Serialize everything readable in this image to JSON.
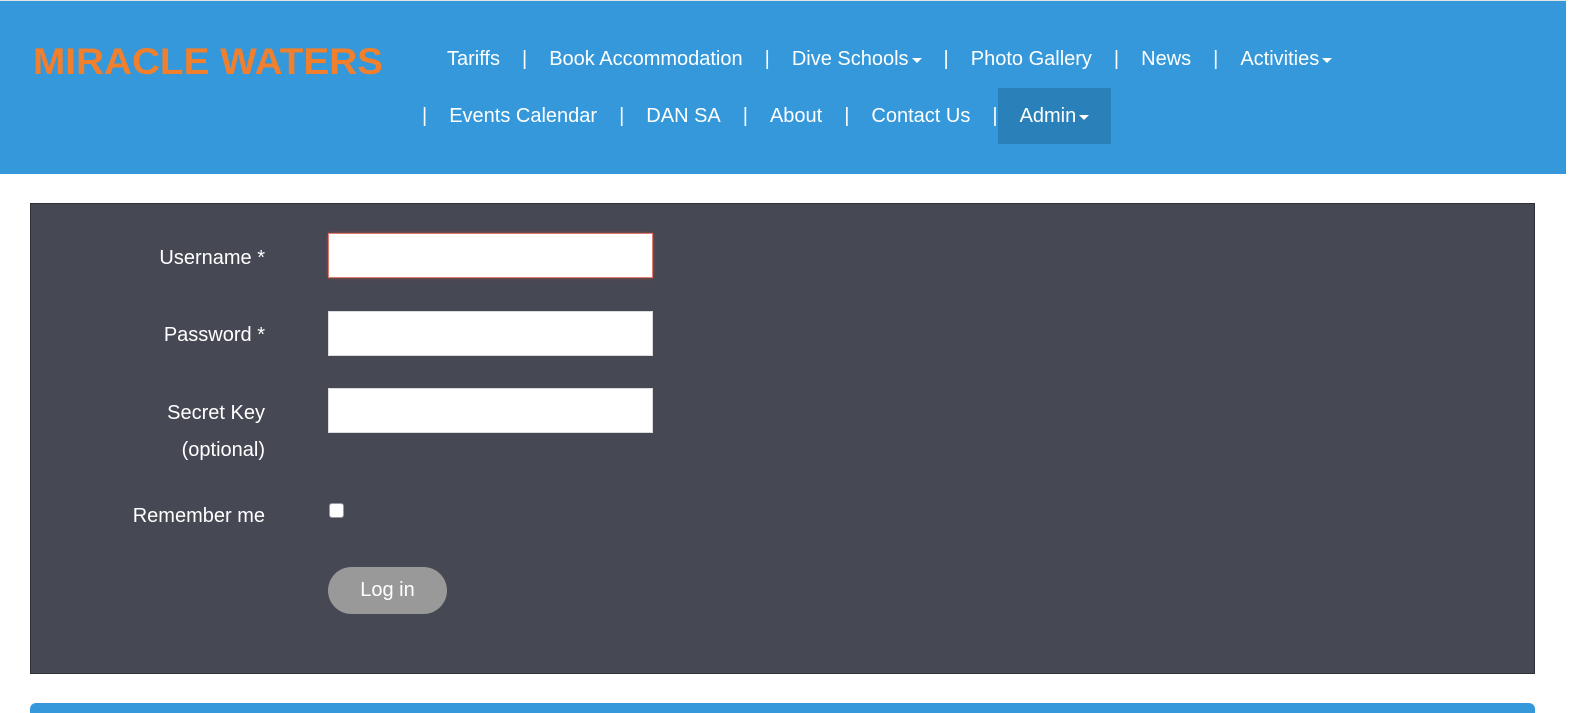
{
  "logo": {
    "text": "MIRACLE WATERS",
    "color": "#f07f2e"
  },
  "nav": {
    "row1": [
      {
        "label": "Tariffs",
        "dropdown": false
      },
      {
        "label": "Book Accommodation",
        "dropdown": false
      },
      {
        "label": "Dive Schools",
        "dropdown": true
      },
      {
        "label": "Photo Gallery",
        "dropdown": false
      },
      {
        "label": "News",
        "dropdown": false
      },
      {
        "label": "Activities",
        "dropdown": true
      }
    ],
    "row2": [
      {
        "label": "Events Calendar",
        "dropdown": false
      },
      {
        "label": "DAN SA",
        "dropdown": false
      },
      {
        "label": "About",
        "dropdown": false
      },
      {
        "label": "Contact Us",
        "dropdown": false
      },
      {
        "label": "Admin",
        "dropdown": true,
        "active": true
      }
    ],
    "separator": "|"
  },
  "form": {
    "username_label": "Username *",
    "username_value": "",
    "password_label": "Password *",
    "password_value": "",
    "secret_label_line1": "Secret Key",
    "secret_label_line2": "(optional)",
    "secret_value": "",
    "remember_label": "Remember me",
    "remember_checked": false,
    "login_button": "Log in"
  },
  "colors": {
    "header_bg": "#3498db",
    "panel_bg": "#464853",
    "button_bg": "#999999",
    "active_nav_bg": "#2a80b9"
  }
}
